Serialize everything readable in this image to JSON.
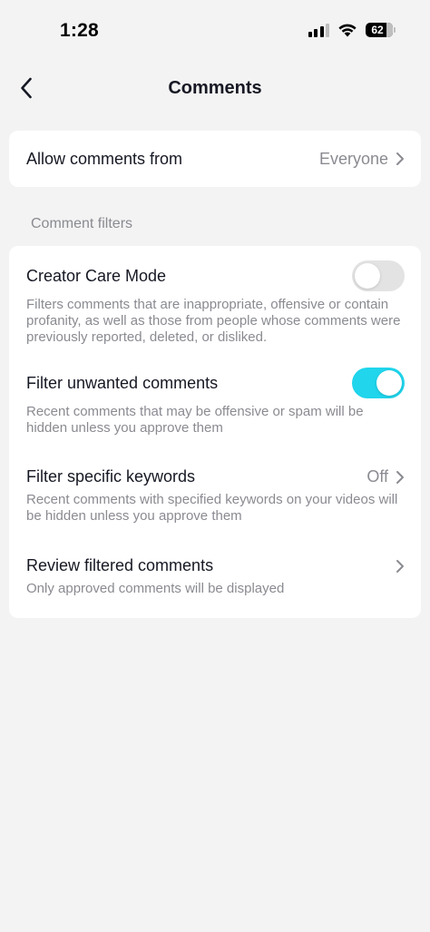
{
  "status_bar": {
    "time": "1:28",
    "battery": "62",
    "icons": [
      "cellular-signal-icon",
      "wifi-icon",
      "battery-icon"
    ]
  },
  "nav": {
    "title": "Comments",
    "back_icon": "chevron-left-icon"
  },
  "allow_comments": {
    "label": "Allow comments from",
    "value": "Everyone"
  },
  "section": {
    "label": "Comment filters"
  },
  "filters": [
    {
      "title": "Creator Care Mode",
      "description": "Filters comments that are inappropriate, offensive or contain profanity, as well as those from people whose comments were previously reported, deleted, or disliked.",
      "control": "toggle",
      "enabled": false
    },
    {
      "title": "Filter unwanted comments",
      "description": "Recent comments that may be offensive or spam will be hidden unless you approve them",
      "control": "toggle",
      "enabled": true
    },
    {
      "title": "Filter specific keywords",
      "description": "Recent comments with specified keywords on your videos will be hidden unless you approve them",
      "control": "link",
      "value": "Off"
    },
    {
      "title": "Review filtered comments",
      "description": "Only approved comments will be displayed",
      "control": "link"
    }
  ],
  "colors": {
    "background": "#f3f3f3",
    "card": "#ffffff",
    "toggle_on": "#20d5ec",
    "toggle_off": "#e3e3e4",
    "secondary_text": "#8a8b91",
    "primary_text": "#161823"
  }
}
